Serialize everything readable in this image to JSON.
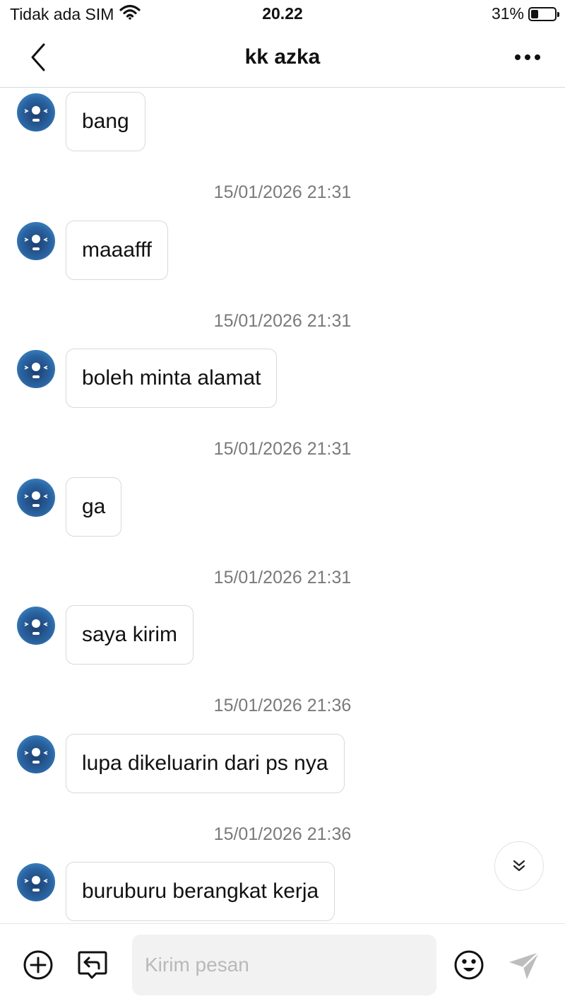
{
  "status_bar": {
    "carrier": "Tidak ada SIM",
    "time": "20.22",
    "battery": "31%",
    "battery_level": 0.31
  },
  "header": {
    "title": "kk azka",
    "back_icon": "chevron-left-icon",
    "more_icon": "more-horizontal-icon"
  },
  "messages": [
    {
      "text": "bang",
      "timestamp_after": "15/01/2026 21:31"
    },
    {
      "text": "maaafff",
      "timestamp_after": "15/01/2026 21:31"
    },
    {
      "text": "boleh minta alamat",
      "timestamp_after": "15/01/2026 21:31"
    },
    {
      "text": "ga",
      "timestamp_after": "15/01/2026 21:31"
    },
    {
      "text": "saya kirim",
      "timestamp_after": "15/01/2026 21:36"
    },
    {
      "text": "lupa dikeluarin dari ps nya",
      "timestamp_after": "15/01/2026 21:36"
    },
    {
      "text": "buruburu berangkat kerja"
    }
  ],
  "input_bar": {
    "placeholder": "Kirim pesan",
    "value": "",
    "icons": [
      "plus-circle-icon",
      "reply-icon",
      "emoji-icon",
      "send-icon"
    ]
  },
  "colors": {
    "bubble_border": "#d9d9d9",
    "timestamp": "#7a7a7a",
    "input_bg": "#f2f2f2",
    "send_icon": "#bdbdbd"
  }
}
